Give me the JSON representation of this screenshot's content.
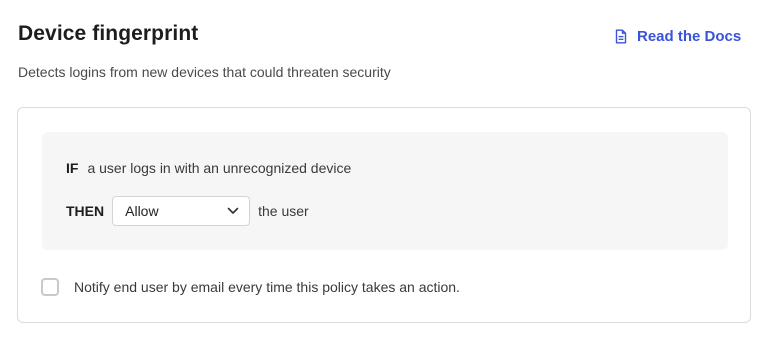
{
  "header": {
    "title": "Device fingerprint",
    "subtitle": "Detects logins from new devices that could threaten security",
    "docs_link_label": "Read the Docs",
    "docs_icon": "document-icon"
  },
  "rule": {
    "if_keyword": "IF",
    "condition": "a user logs in with an unrecognized device",
    "then_keyword": "THEN",
    "action_selected": "Allow",
    "action_suffix": "the user"
  },
  "notify": {
    "label": "Notify end user by email every time this policy takes an action.",
    "checked": false
  },
  "colors": {
    "accent": "#3a54d8",
    "rule_background": "#f6f6f6",
    "border": "#dcdcdc"
  }
}
